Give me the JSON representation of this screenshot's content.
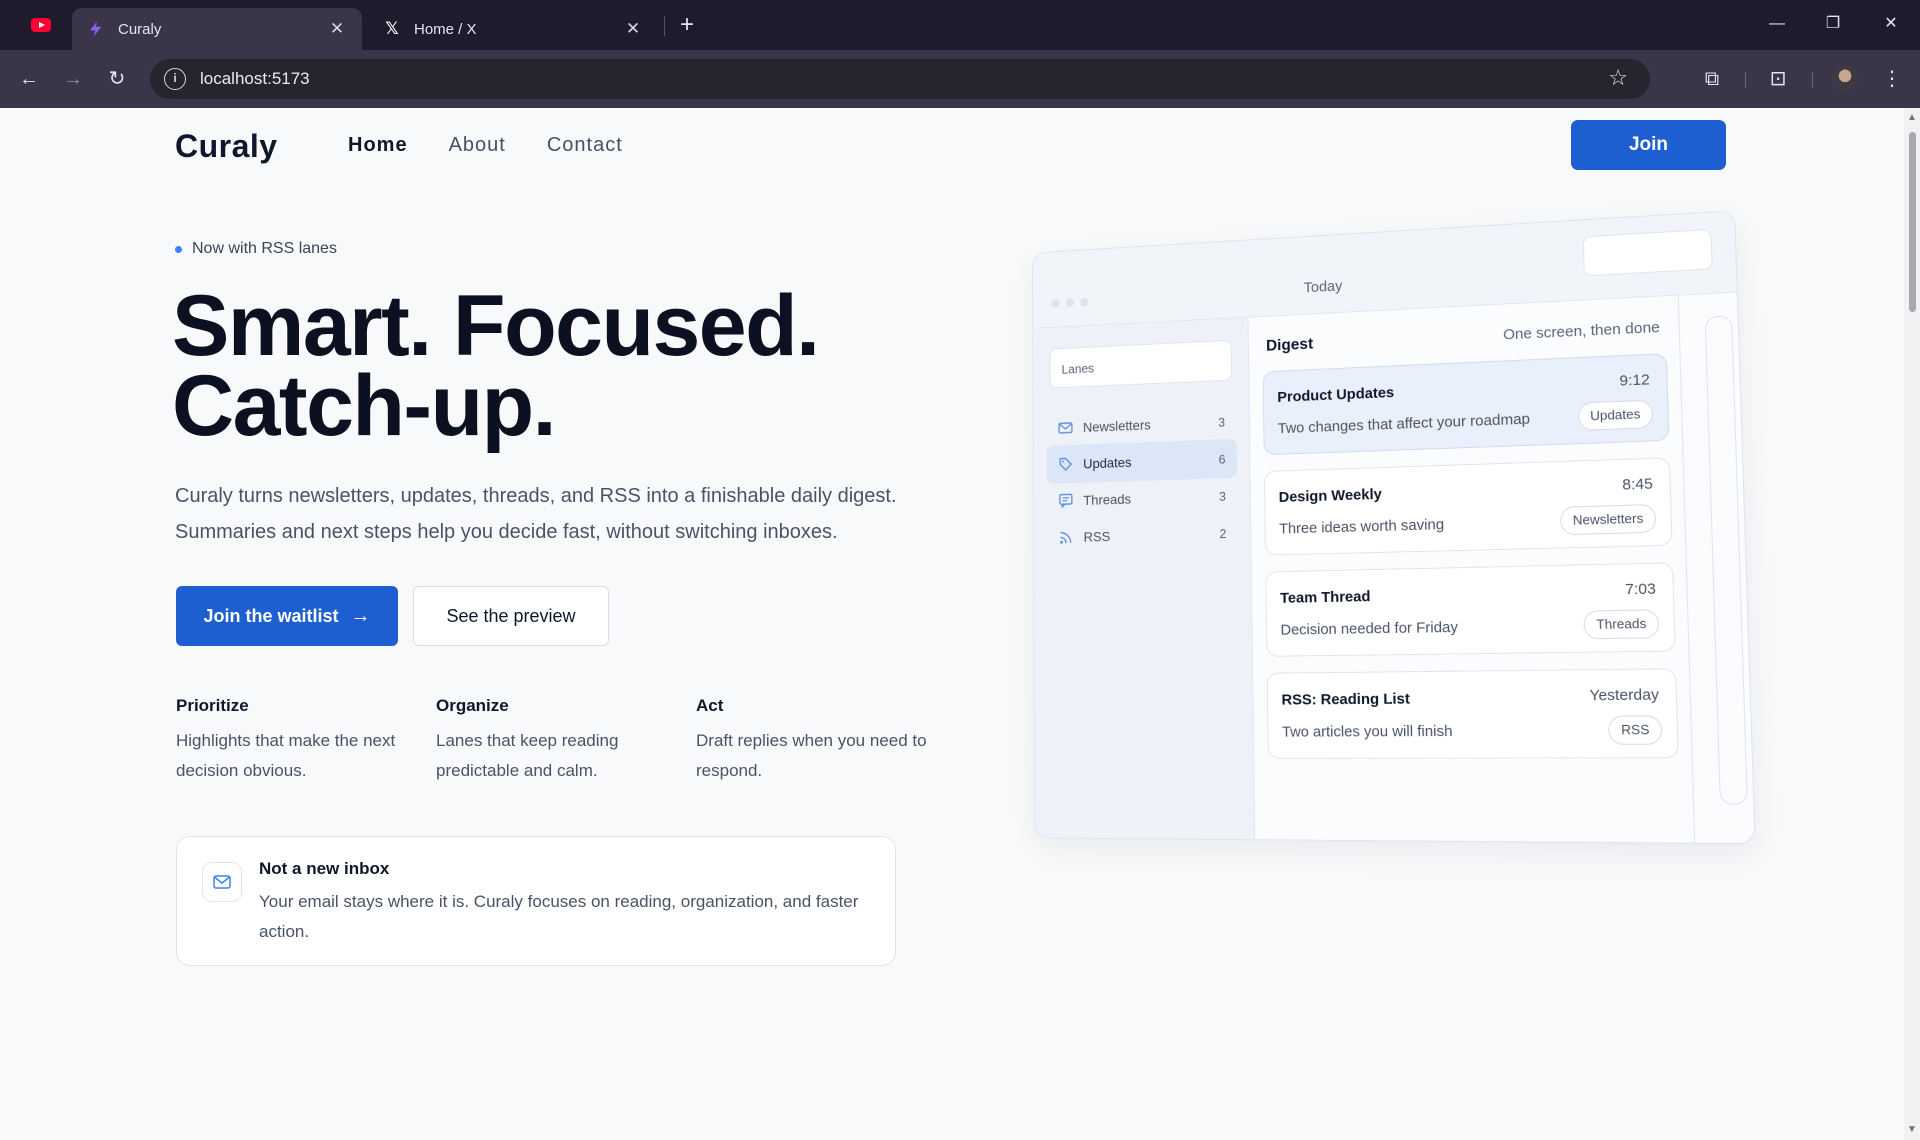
{
  "browser": {
    "tabs": [
      {
        "title": "Curaly",
        "active": true
      },
      {
        "title": "Home / X",
        "active": false
      }
    ],
    "url": "localhost:5173"
  },
  "header": {
    "brand": "Curaly",
    "nav": [
      "Home",
      "About",
      "Contact"
    ],
    "active_nav": "Home",
    "join_label": "Join"
  },
  "hero": {
    "eyebrow": "Now with RSS lanes",
    "headline_line1": "Smart. Focused.",
    "headline_line2": "Catch-up.",
    "lead": "Curaly turns newsletters, updates, threads, and RSS into a finishable daily digest. Summaries and next steps help you decide fast, without switching inboxes.",
    "primary_cta": "Join the waitlist",
    "secondary_cta": "See the preview"
  },
  "features": [
    {
      "title": "Prioritize",
      "body": "Highlights that make the next decision obvious."
    },
    {
      "title": "Organize",
      "body": "Lanes that keep reading predictable and calm."
    },
    {
      "title": "Act",
      "body": "Draft replies when you need to respond."
    }
  ],
  "note": {
    "title": "Not a new inbox",
    "body": "Your email stays where it is. Curaly focuses on reading, organization, and faster action."
  },
  "mockup": {
    "top_label": "Today",
    "lanes_placeholder": "Lanes",
    "lanes": [
      {
        "name": "Newsletters",
        "count": "3",
        "icon": "mail-icon"
      },
      {
        "name": "Updates",
        "count": "6",
        "icon": "tag-icon",
        "selected": true
      },
      {
        "name": "Threads",
        "count": "3",
        "icon": "chat-icon"
      },
      {
        "name": "RSS",
        "count": "2",
        "icon": "rss-icon"
      }
    ],
    "digest_title": "Digest",
    "digest_sub": "One screen, then done",
    "items": [
      {
        "title": "Product Updates",
        "time": "9:12",
        "desc": "Two changes that affect your roadmap",
        "tag": "Updates",
        "highlight": true
      },
      {
        "title": "Design Weekly",
        "time": "8:45",
        "desc": "Three ideas worth saving",
        "tag": "Newsletters"
      },
      {
        "title": "Team Thread",
        "time": "7:03",
        "desc": "Decision needed for Friday",
        "tag": "Threads"
      },
      {
        "title": "RSS: Reading List",
        "time": "Yesterday",
        "desc": "Two articles you will finish",
        "tag": "RSS"
      }
    ]
  },
  "colors": {
    "accent": "#1d5fd0",
    "dot": "#3b82f6",
    "text_dark": "#0f172a",
    "text_muted": "#4a5365"
  }
}
